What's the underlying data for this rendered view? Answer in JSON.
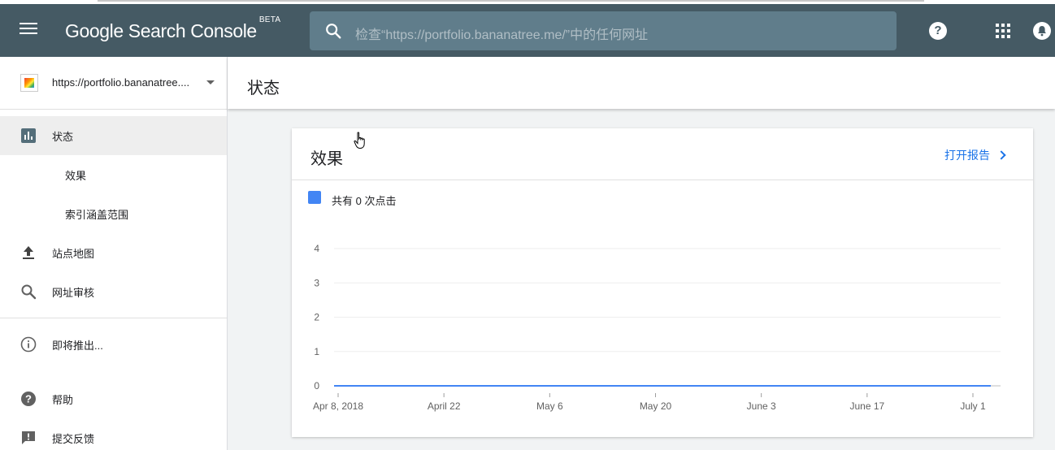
{
  "header": {
    "brand": "Google Search Console",
    "beta": "BETA",
    "search_placeholder": "检查“https://portfolio.bananatree.me/”中的任何网址",
    "help_symbol": "?"
  },
  "sidebar": {
    "property_url": "https://portfolio.bananatree....",
    "items": [
      {
        "label": "状态",
        "icon": "bar-chart-icon"
      },
      {
        "label": "效果"
      },
      {
        "label": "索引涵盖范围"
      },
      {
        "label": "站点地图",
        "icon": "upload-icon"
      },
      {
        "label": "网址审核",
        "icon": "search-icon"
      },
      {
        "label": "即将推出...",
        "icon": "info-icon"
      },
      {
        "label": "帮助",
        "icon": "help-icon"
      },
      {
        "label": "提交反馈",
        "icon": "feedback-icon"
      }
    ]
  },
  "page": {
    "title": "状态"
  },
  "card": {
    "title": "效果",
    "open_report": "打开报告",
    "legend": "共有 0 次点击",
    "series_color": "#4285f4"
  },
  "chart_data": {
    "type": "line",
    "x": [
      "Apr 8, 2018",
      "April 22",
      "May 6",
      "May 20",
      "June 3",
      "June 17",
      "July 1"
    ],
    "series": [
      {
        "name": "共有 0 次点击",
        "values": [
          0,
          0,
          0,
          0,
          0,
          0,
          0
        ]
      }
    ],
    "yticks": [
      0,
      1,
      2,
      3,
      4
    ],
    "ylim": [
      0,
      4
    ],
    "grid": true
  }
}
